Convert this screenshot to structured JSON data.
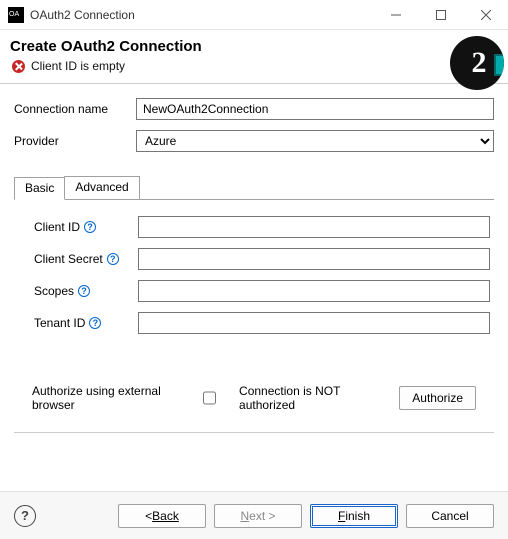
{
  "window": {
    "title": "OAuth2 Connection",
    "badge_char": "2"
  },
  "banner": {
    "heading": "Create OAuth2 Connection",
    "error": "Client ID is empty"
  },
  "form": {
    "connection_name_label": "Connection name",
    "connection_name_value": "NewOAuth2Connection",
    "provider_label": "Provider",
    "provider_value": "Azure"
  },
  "tabs": {
    "basic": "Basic",
    "advanced": "Advanced"
  },
  "fields": {
    "client_id": {
      "label": "Client ID",
      "value": ""
    },
    "client_secret": {
      "label": "Client Secret",
      "value": ""
    },
    "scopes": {
      "label": "Scopes",
      "value": ""
    },
    "tenant_id": {
      "label": "Tenant ID",
      "value": ""
    }
  },
  "auth": {
    "checkbox_label": "Authorize using external browser",
    "checked": false,
    "status": "Connection is NOT authorized",
    "authorize_btn": "Authorize"
  },
  "footer": {
    "back": "Back",
    "next": "Next >",
    "finish": "Finish",
    "cancel": "Cancel"
  }
}
